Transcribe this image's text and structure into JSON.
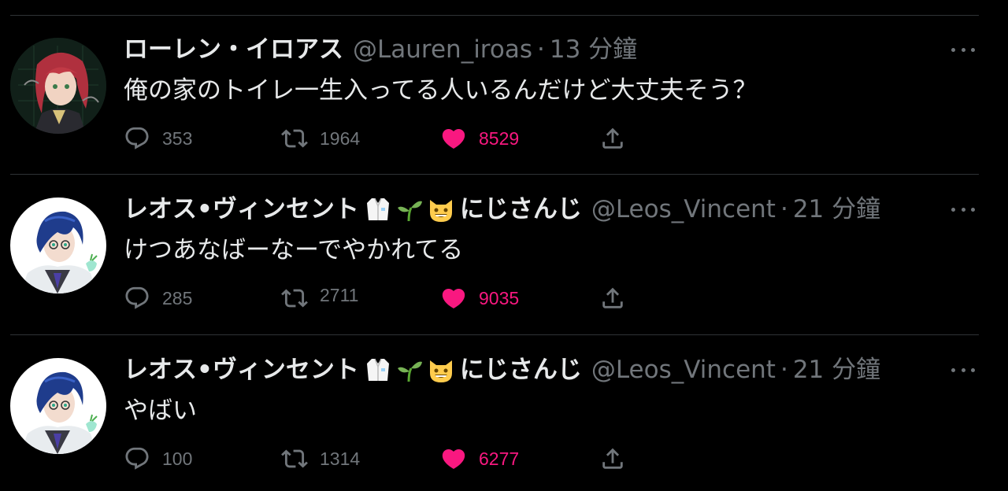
{
  "tweets": [
    {
      "name": "ローレン・イロアス",
      "name_suffix": "",
      "emojis": [],
      "handle": "@Lauren_iroas",
      "dot": "·",
      "time": "13 分鐘",
      "text": "俺の家のトイレ一生入ってる人いるんだけど大丈夫そう？",
      "replies": "353",
      "retweets": "1964",
      "likes": "8529",
      "liked": true,
      "avatar": "red-haired-character"
    },
    {
      "name": "レオス•ヴィンセント",
      "name_suffix": "にじさんじ",
      "emojis": [
        "lab-coat-emoji",
        "seedling-emoji",
        "grinning-cat-emoji"
      ],
      "handle": "@Leos_Vincent",
      "dot": "·",
      "time": "21 分鐘",
      "text": "けつあなばーなーでやかれてる",
      "replies": "285",
      "retweets": "2711",
      "likes": "9035",
      "liked": true,
      "avatar": "blue-haired-character"
    },
    {
      "name": "レオス•ヴィンセント",
      "name_suffix": "にじさんじ",
      "emojis": [
        "lab-coat-emoji",
        "seedling-emoji",
        "grinning-cat-emoji"
      ],
      "handle": "@Leos_Vincent",
      "dot": "·",
      "time": "21 分鐘",
      "text": "やばい",
      "replies": "100",
      "retweets": "1314",
      "likes": "6277",
      "liked": true,
      "avatar": "blue-haired-character"
    }
  ],
  "colors": {
    "background": "#000000",
    "text": "#e7e9ea",
    "muted": "#71767b",
    "like": "#f91880",
    "divider": "#2f3336"
  }
}
